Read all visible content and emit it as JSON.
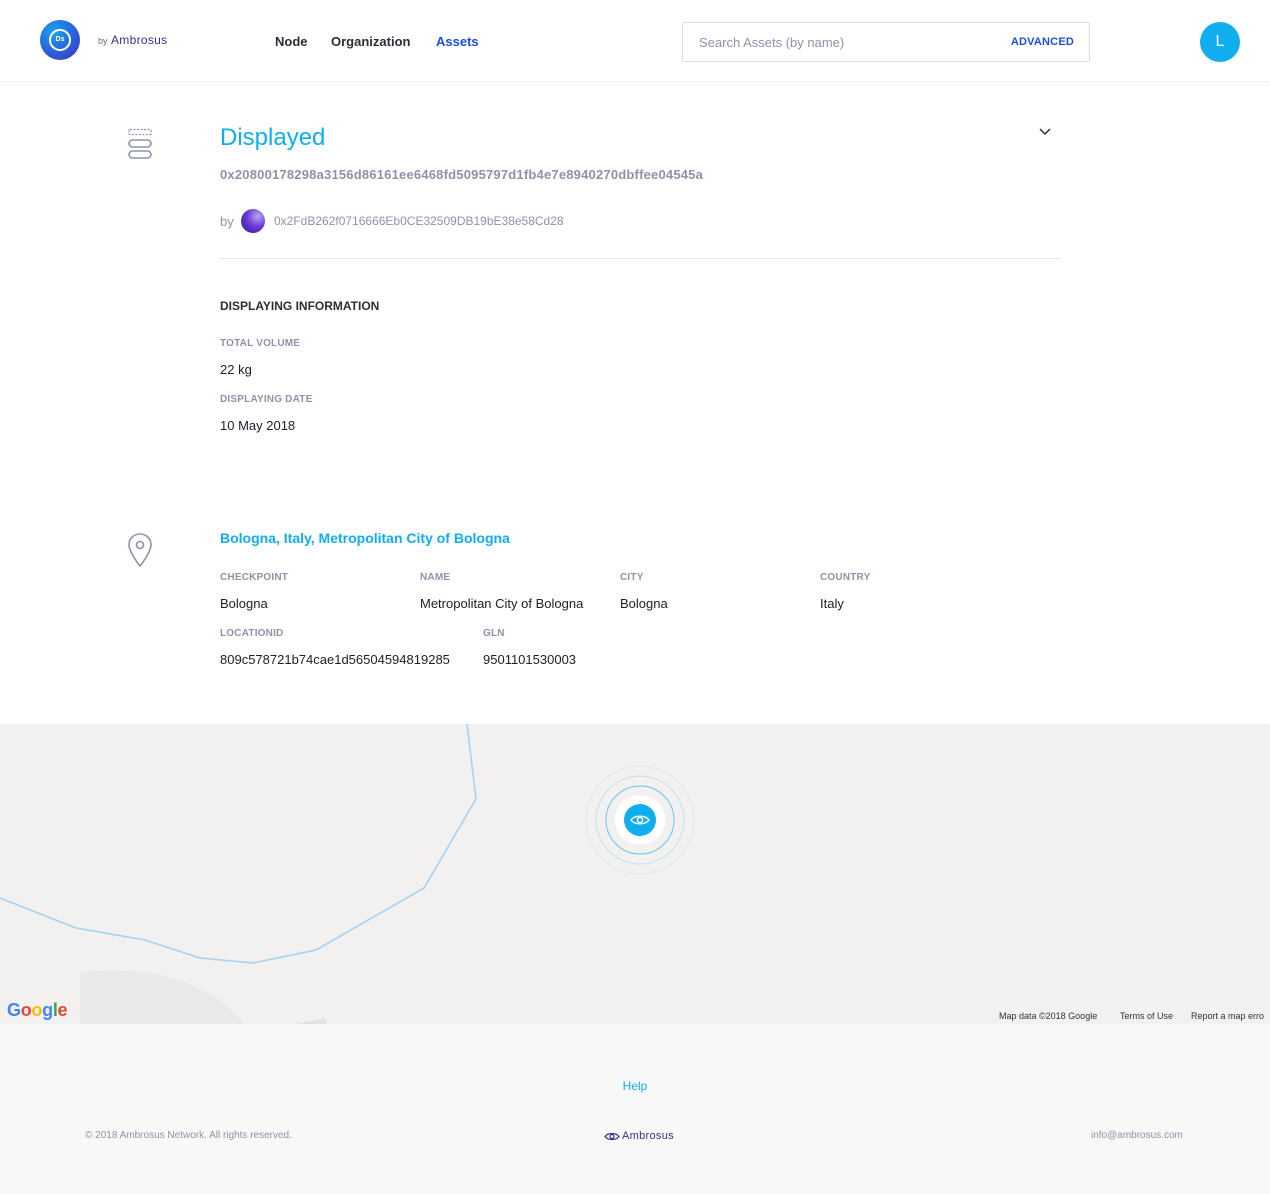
{
  "header": {
    "logo_text": "Ds",
    "by": "by",
    "brand": "Ambrosus",
    "nav": [
      {
        "label": "Node",
        "active": false
      },
      {
        "label": "Organization",
        "active": false
      },
      {
        "label": "Assets",
        "active": true
      }
    ],
    "search_placeholder": "Search Assets (by name)",
    "search_value": "",
    "advanced_label": "ADVANCED",
    "avatar_initial": "L",
    "accent_color": "#10aeee",
    "nav_active_color": "#1c4fd8"
  },
  "event": {
    "icon": "event-stack-icon",
    "title": "Displayed",
    "hash": "0x20800178298a3156d86161ee6468fd5095797d1fb4e7e8940270dbffee04545a",
    "by_label": "by",
    "author_address": "0x2FdB262f0716666Eb0CE32509DB19bE38e58Cd28",
    "section_title": "DISPLAYING INFORMATION",
    "fields": [
      {
        "label": "TOTAL VOLUME",
        "value": "22 kg"
      },
      {
        "label": "DISPLAYING DATE",
        "value": "10 May 2018"
      }
    ]
  },
  "location": {
    "icon": "map-pin-icon",
    "title": "Bologna, Italy, Metropolitan City of Bologna",
    "fields_row1": [
      {
        "label": "CHECKPOINT",
        "value": "Bologna"
      },
      {
        "label": "NAME",
        "value": "Metropolitan City of Bologna"
      },
      {
        "label": "CITY",
        "value": "Bologna"
      },
      {
        "label": "COUNTRY",
        "value": "Italy"
      }
    ],
    "fields_row2": [
      {
        "label": "LOCATIONID",
        "value": "809c578721b74cae1d56504594819285"
      },
      {
        "label": "GLN",
        "value": "9501101530003"
      }
    ]
  },
  "map": {
    "marker_icon": "eye-icon",
    "google_logo": "Google",
    "footer_items": [
      "Map data ©2018 Google",
      "Terms of Use",
      "Report a map erro"
    ]
  },
  "footer": {
    "help": "Help",
    "copyright": "© 2018 Ambrosus Network. All rights reserved.",
    "brand": "Ambrosus",
    "email": "info@ambrosus.com"
  }
}
